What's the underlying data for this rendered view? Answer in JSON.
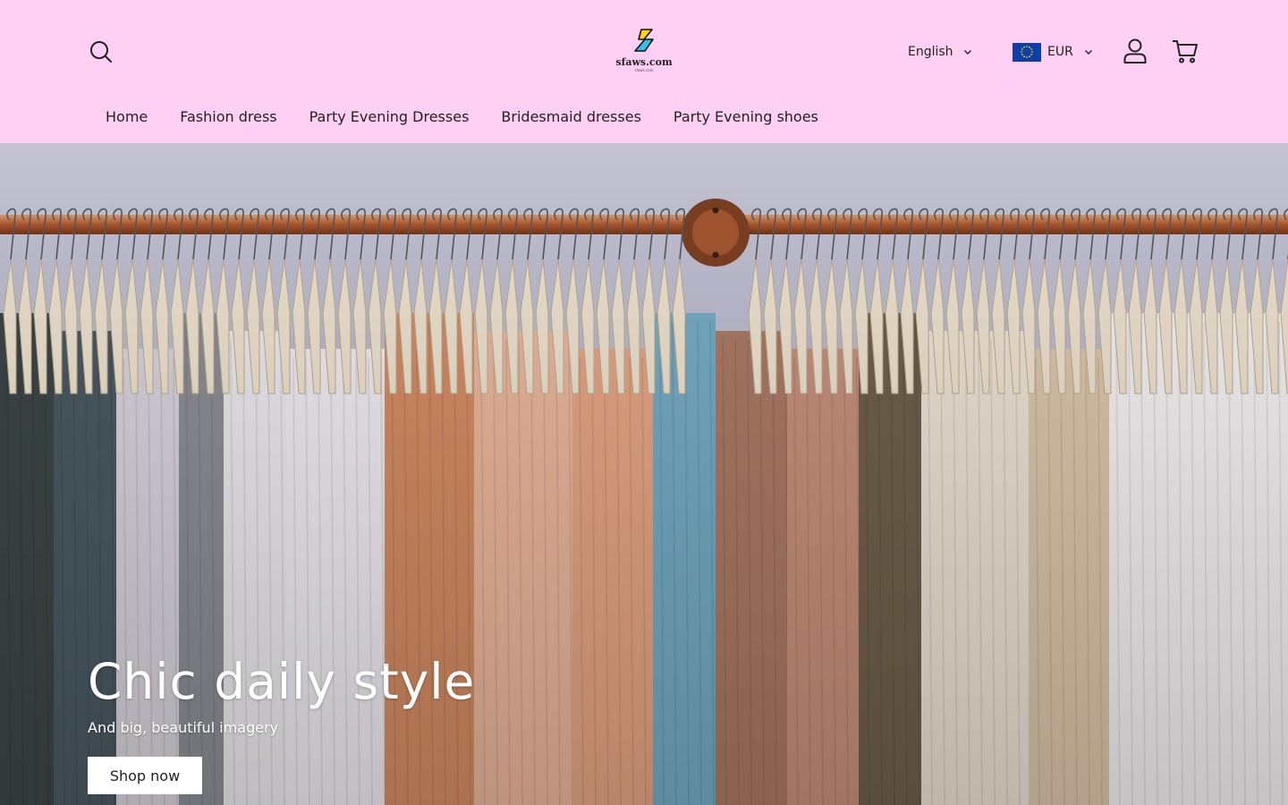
{
  "header": {
    "background": "#ffd0f4",
    "logo": {
      "text": "sfaws.com",
      "subtext": "sfaws.com"
    },
    "language": {
      "selected": "English"
    },
    "currency": {
      "selected": "EUR",
      "flag": "eu-flag"
    },
    "icons": [
      "search-icon",
      "account-icon",
      "cart-icon"
    ]
  },
  "nav": {
    "items": [
      {
        "label": "Home"
      },
      {
        "label": "Fashion dress"
      },
      {
        "label": "Party Evening Dresses"
      },
      {
        "label": "Bridesmaid dresses"
      },
      {
        "label": "Party Evening shoes"
      }
    ]
  },
  "hero": {
    "title": "Chic daily style",
    "subtitle": "And big, beautiful imagery",
    "button_label": "Shop now"
  }
}
